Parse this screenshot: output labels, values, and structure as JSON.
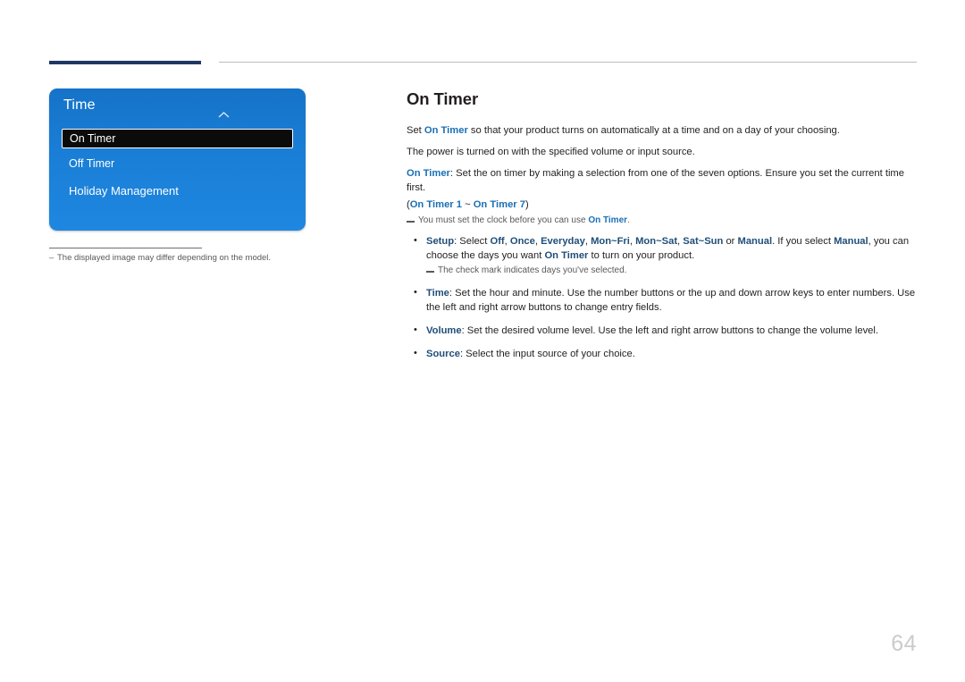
{
  "menu": {
    "title": "Time",
    "chevron_icon": "chevron-up-icon",
    "items": [
      {
        "label": "On Timer",
        "selected": true
      },
      {
        "label": "Off Timer",
        "selected": false
      },
      {
        "label": "Holiday Management",
        "selected": false
      }
    ]
  },
  "footnote": {
    "dash": "–",
    "text": "The displayed image may differ depending on the model."
  },
  "content": {
    "title": "On Timer",
    "p1_a": "Set ",
    "p1_b": "On Timer",
    "p1_c": " so that your product turns on automatically at a time and on a day of your choosing.",
    "p2": "The power is turned on with the specified volume or input source.",
    "p3_a": "On Timer",
    "p3_b": ": Set the on timer by making a selection from one of the seven options. Ensure you set the current time first.",
    "p4_open": "(",
    "p4_a": "On Timer 1",
    "p4_mid": " ~ ",
    "p4_b": "On Timer 7",
    "p4_close": ")",
    "note1_a": "You must set the clock before you can use ",
    "note1_b": "On Timer",
    "note1_c": ".",
    "bullets": [
      {
        "label": "Setup",
        "text_a": ": Select ",
        "options": [
          "Off",
          "Once",
          "Everyday",
          "Mon~Fri",
          "Mon~Sat",
          "Sat~Sun"
        ],
        "text_b": " or ",
        "manual": "Manual",
        "text_c": ". If you select ",
        "manual2": "Manual",
        "text_d": ", you can choose the days you want ",
        "ontimer": "On Timer",
        "text_e": " to turn on your product.",
        "note": "The check mark indicates days you've selected."
      },
      {
        "label": "Time",
        "text": ": Set the hour and minute. Use the number buttons or the up and down arrow keys to enter numbers. Use the left and right arrow buttons to change entry fields."
      },
      {
        "label": "Volume",
        "text": ": Set the desired volume level. Use the left and right arrow buttons to change the volume level."
      },
      {
        "label": "Source",
        "text": ": Select the input source of your choice."
      }
    ]
  },
  "page_number": "64"
}
